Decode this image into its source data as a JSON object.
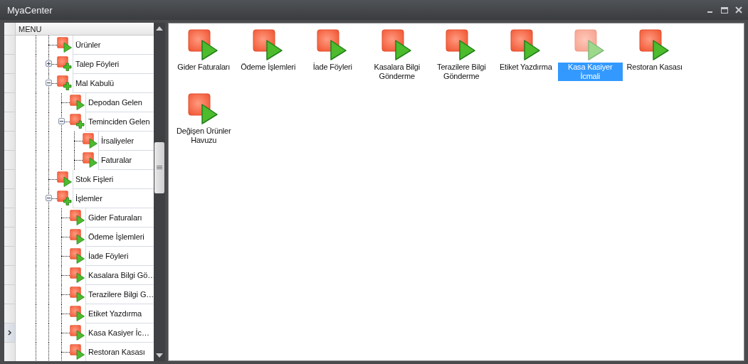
{
  "window": {
    "title": "MyaCenter"
  },
  "tree": {
    "header": "MENU",
    "items": [
      {
        "label": "Ürünler",
        "kind": "form",
        "selected": false
      },
      {
        "label": "Talep Föyleri",
        "kind": "group",
        "expanded": false,
        "selected": false
      },
      {
        "label": "Mal Kabulü",
        "kind": "group",
        "expanded": true,
        "selected": false,
        "children": [
          {
            "label": "Depodan Gelen",
            "kind": "form",
            "selected": false
          },
          {
            "label": "Teminciden Gelen",
            "kind": "group",
            "expanded": true,
            "selected": false,
            "children": [
              {
                "label": "İrsaliyeler",
                "kind": "form",
                "selected": false
              },
              {
                "label": "Faturalar",
                "kind": "form",
                "selected": false
              }
            ]
          }
        ]
      },
      {
        "label": "Stok Fişleri",
        "kind": "form",
        "selected": false
      },
      {
        "label": "İşlemler",
        "kind": "group",
        "expanded": true,
        "selected": false,
        "children": [
          {
            "label": "Gider Faturaları",
            "kind": "form",
            "selected": false
          },
          {
            "label": "Ödeme İşlemleri",
            "kind": "form",
            "selected": false
          },
          {
            "label": "İade Föyleri",
            "kind": "form",
            "selected": false
          },
          {
            "label": "Kasalara Bilgi Gö…",
            "kind": "form",
            "selected": false
          },
          {
            "label": "Terazilere Bilgi G…",
            "kind": "form",
            "selected": false
          },
          {
            "label": "Etiket Yazdırma",
            "kind": "form",
            "selected": false
          },
          {
            "label": "Kasa Kasiyer İc…",
            "kind": "form",
            "selected": true
          },
          {
            "label": "Restoran Kasası",
            "kind": "form",
            "selected": false
          }
        ]
      }
    ]
  },
  "shortcuts": [
    {
      "label": "Gider Faturaları",
      "selected": false
    },
    {
      "label": "Ödeme İşlemleri",
      "selected": false
    },
    {
      "label": "İade Föyleri",
      "selected": false
    },
    {
      "label": "Kasalara Bilgi Gönderme",
      "selected": false
    },
    {
      "label": "Terazilere Bilgi Gönderme",
      "selected": false
    },
    {
      "label": "Etiket Yazdırma",
      "selected": false
    },
    {
      "label": "Kasa Kasiyer İcmali",
      "selected": true
    },
    {
      "label": "Restoran Kasası",
      "selected": false
    },
    {
      "label": "Değişen Ürünler Havuzu",
      "selected": false
    }
  ]
}
